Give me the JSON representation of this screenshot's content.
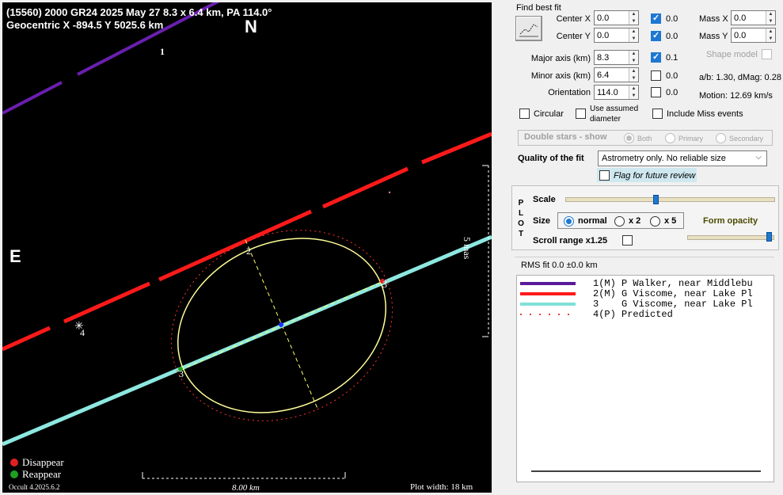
{
  "plot": {
    "header_line1": "(15560) 2000 GR24  2025 May 27  8.3 x 6.4 km, PA 114.0°",
    "header_line2": "Geocentric X  -894.5  Y 5025.6 km",
    "north": "N",
    "east": "E",
    "scale_label": "5 mas",
    "bottom_scale": "8.00 km",
    "plot_width": "Plot width: 18 km",
    "version": "Occult 4.2025.6.2",
    "legend": {
      "disappear": "Disappear",
      "reappear": "Reappear",
      "disappear_color": "#e02020",
      "reappear_color": "#20a020"
    },
    "chord_labels": [
      "1",
      "2",
      "3",
      "4"
    ],
    "colors": {
      "chord1": "#6a1fb0",
      "chord2": "#ff1a1a",
      "chord3": "#8de8e0",
      "ellipse": "#ffff99",
      "predicted": "#ff3030"
    }
  },
  "panel": {
    "find_best_fit": "Find best fit",
    "fit_icon": "graph-fit-icon",
    "center_x": {
      "label": "Center X",
      "value": "0.0",
      "check": "0.0"
    },
    "center_y": {
      "label": "Center Y",
      "value": "0.0",
      "check": "0.0"
    },
    "mass_x": {
      "label": "Mass X",
      "value": "0.0"
    },
    "mass_y": {
      "label": "Mass Y",
      "value": "0.0"
    },
    "shape_model": "Shape model",
    "major_axis": {
      "label": "Major axis (km)",
      "value": "8.3",
      "check": "0.1"
    },
    "minor_axis": {
      "label": "Minor axis (km)",
      "value": "6.4",
      "check": "0.0"
    },
    "orientation": {
      "label": "Orientation",
      "value": "114.0",
      "check": "0.0"
    },
    "ab_dmag": "a/b: 1.30, dMag: 0.28",
    "motion": "Motion: 12.69 km/s",
    "circular": "Circular",
    "use_assumed": "Use assumed",
    "diameter": "diameter",
    "include_miss": "Include Miss events",
    "double_stars": "Double stars - show",
    "both": "Both",
    "primary": "Primary",
    "secondary": "Secondary",
    "quality_label": "Quality of the fit",
    "quality_value": "Astrometry only. No reliable size",
    "flag_review": "Flag for future review",
    "plot_vertical": [
      "P",
      "L",
      "O",
      "T"
    ],
    "scale": "Scale",
    "size": "Size",
    "size_normal": "normal",
    "size_x2": "x 2",
    "size_x5": "x 5",
    "form_opacity": "Form opacity",
    "scroll_range": "Scroll range x1.25",
    "rms_fit": "RMS fit 0.0 ±0.0 km",
    "chords": [
      {
        "num": "1",
        "type": "(M)",
        "observer": "P Walker, near Middlebu",
        "color": "#5a1a9a",
        "style": "solid"
      },
      {
        "num": "2",
        "type": "(M)",
        "observer": "G Viscome, near Lake Pl",
        "color": "#ff1a1a",
        "style": "solid"
      },
      {
        "num": "3",
        "type": "",
        "observer": "G Viscome, near Lake Pl",
        "color": "#7fe0d8",
        "style": "solid"
      },
      {
        "num": "4",
        "type": "(P)",
        "observer": "Predicted",
        "color": "#e04040",
        "style": "dotted"
      }
    ]
  }
}
